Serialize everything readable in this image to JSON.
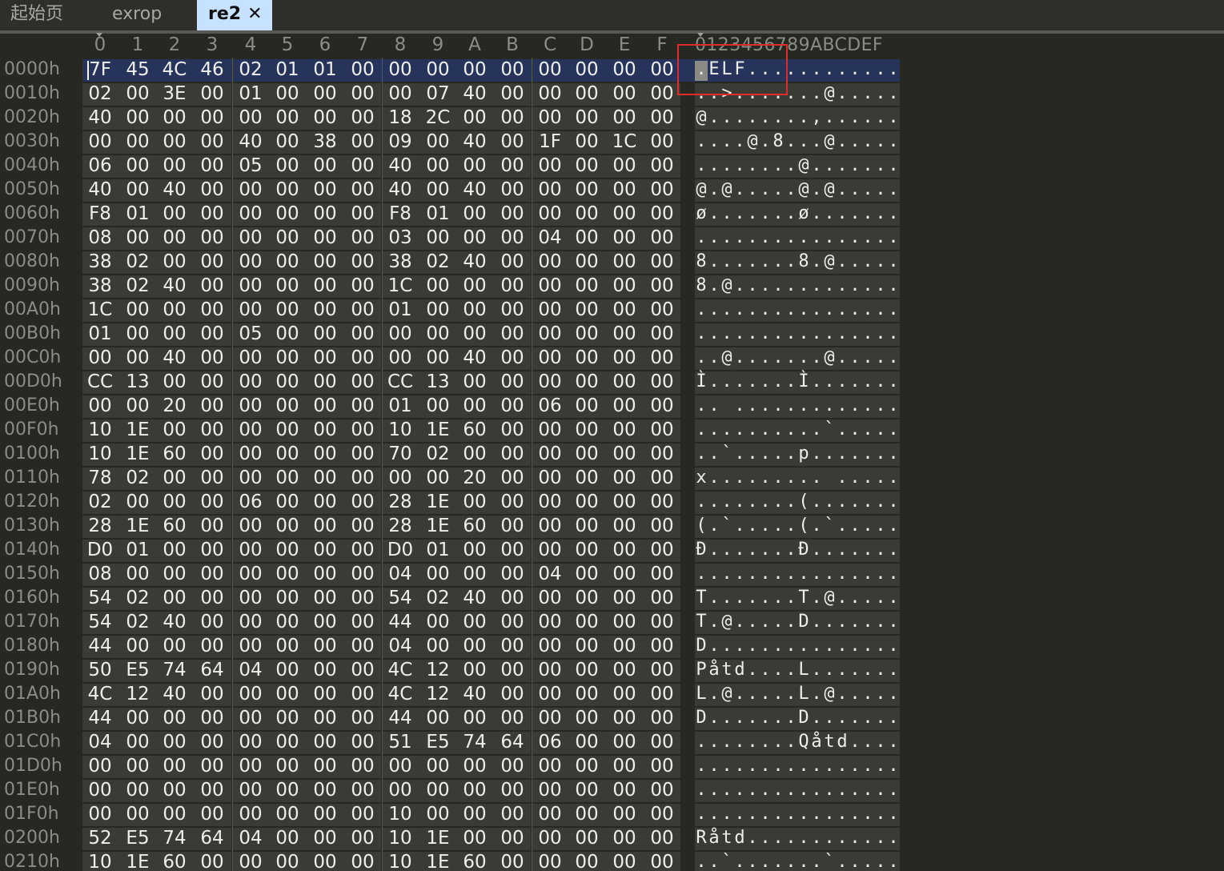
{
  "tabs": [
    {
      "label": "起始页",
      "active": false
    },
    {
      "label": "exrop",
      "active": false
    },
    {
      "label": "re2",
      "active": true
    }
  ],
  "tab_close_icon": "close-icon",
  "column_headers": [
    "0",
    "1",
    "2",
    "3",
    "4",
    "5",
    "6",
    "7",
    "8",
    "9",
    "A",
    "B",
    "C",
    "D",
    "E",
    "F"
  ],
  "ascii_header": "0123456789ABCDEF",
  "rows": [
    {
      "offset": "0000h",
      "bytes": [
        "7F",
        "45",
        "4C",
        "46",
        "02",
        "01",
        "01",
        "00",
        "00",
        "00",
        "00",
        "00",
        "00",
        "00",
        "00",
        "00"
      ],
      "ascii": ".ELF............"
    },
    {
      "offset": "0010h",
      "bytes": [
        "02",
        "00",
        "3E",
        "00",
        "01",
        "00",
        "00",
        "00",
        "00",
        "07",
        "40",
        "00",
        "00",
        "00",
        "00",
        "00"
      ],
      "ascii": "..>.......@....."
    },
    {
      "offset": "0020h",
      "bytes": [
        "40",
        "00",
        "00",
        "00",
        "00",
        "00",
        "00",
        "00",
        "18",
        "2C",
        "00",
        "00",
        "00",
        "00",
        "00",
        "00"
      ],
      "ascii": "@........,......"
    },
    {
      "offset": "0030h",
      "bytes": [
        "00",
        "00",
        "00",
        "00",
        "40",
        "00",
        "38",
        "00",
        "09",
        "00",
        "40",
        "00",
        "1F",
        "00",
        "1C",
        "00"
      ],
      "ascii": "....@.8...@....."
    },
    {
      "offset": "0040h",
      "bytes": [
        "06",
        "00",
        "00",
        "00",
        "05",
        "00",
        "00",
        "00",
        "40",
        "00",
        "00",
        "00",
        "00",
        "00",
        "00",
        "00"
      ],
      "ascii": "........@......."
    },
    {
      "offset": "0050h",
      "bytes": [
        "40",
        "00",
        "40",
        "00",
        "00",
        "00",
        "00",
        "00",
        "40",
        "00",
        "40",
        "00",
        "00",
        "00",
        "00",
        "00"
      ],
      "ascii": "@.@.....@.@....."
    },
    {
      "offset": "0060h",
      "bytes": [
        "F8",
        "01",
        "00",
        "00",
        "00",
        "00",
        "00",
        "00",
        "F8",
        "01",
        "00",
        "00",
        "00",
        "00",
        "00",
        "00"
      ],
      "ascii": "ø.......ø......."
    },
    {
      "offset": "0070h",
      "bytes": [
        "08",
        "00",
        "00",
        "00",
        "00",
        "00",
        "00",
        "00",
        "03",
        "00",
        "00",
        "00",
        "04",
        "00",
        "00",
        "00"
      ],
      "ascii": "................"
    },
    {
      "offset": "0080h",
      "bytes": [
        "38",
        "02",
        "00",
        "00",
        "00",
        "00",
        "00",
        "00",
        "38",
        "02",
        "40",
        "00",
        "00",
        "00",
        "00",
        "00"
      ],
      "ascii": "8.......8.@....."
    },
    {
      "offset": "0090h",
      "bytes": [
        "38",
        "02",
        "40",
        "00",
        "00",
        "00",
        "00",
        "00",
        "1C",
        "00",
        "00",
        "00",
        "00",
        "00",
        "00",
        "00"
      ],
      "ascii": "8.@............."
    },
    {
      "offset": "00A0h",
      "bytes": [
        "1C",
        "00",
        "00",
        "00",
        "00",
        "00",
        "00",
        "00",
        "01",
        "00",
        "00",
        "00",
        "00",
        "00",
        "00",
        "00"
      ],
      "ascii": "................"
    },
    {
      "offset": "00B0h",
      "bytes": [
        "01",
        "00",
        "00",
        "00",
        "05",
        "00",
        "00",
        "00",
        "00",
        "00",
        "00",
        "00",
        "00",
        "00",
        "00",
        "00"
      ],
      "ascii": "................"
    },
    {
      "offset": "00C0h",
      "bytes": [
        "00",
        "00",
        "40",
        "00",
        "00",
        "00",
        "00",
        "00",
        "00",
        "00",
        "40",
        "00",
        "00",
        "00",
        "00",
        "00"
      ],
      "ascii": "..@.......@....."
    },
    {
      "offset": "00D0h",
      "bytes": [
        "CC",
        "13",
        "00",
        "00",
        "00",
        "00",
        "00",
        "00",
        "CC",
        "13",
        "00",
        "00",
        "00",
        "00",
        "00",
        "00"
      ],
      "ascii": "Ì.......Ì......."
    },
    {
      "offset": "00E0h",
      "bytes": [
        "00",
        "00",
        "20",
        "00",
        "00",
        "00",
        "00",
        "00",
        "01",
        "00",
        "00",
        "00",
        "06",
        "00",
        "00",
        "00"
      ],
      "ascii": ".. ............."
    },
    {
      "offset": "00F0h",
      "bytes": [
        "10",
        "1E",
        "00",
        "00",
        "00",
        "00",
        "00",
        "00",
        "10",
        "1E",
        "60",
        "00",
        "00",
        "00",
        "00",
        "00"
      ],
      "ascii": "..........`....."
    },
    {
      "offset": "0100h",
      "bytes": [
        "10",
        "1E",
        "60",
        "00",
        "00",
        "00",
        "00",
        "00",
        "70",
        "02",
        "00",
        "00",
        "00",
        "00",
        "00",
        "00"
      ],
      "ascii": "..`.....p......."
    },
    {
      "offset": "0110h",
      "bytes": [
        "78",
        "02",
        "00",
        "00",
        "00",
        "00",
        "00",
        "00",
        "00",
        "00",
        "20",
        "00",
        "00",
        "00",
        "00",
        "00"
      ],
      "ascii": "x......... ....."
    },
    {
      "offset": "0120h",
      "bytes": [
        "02",
        "00",
        "00",
        "00",
        "06",
        "00",
        "00",
        "00",
        "28",
        "1E",
        "00",
        "00",
        "00",
        "00",
        "00",
        "00"
      ],
      "ascii": "........(......."
    },
    {
      "offset": "0130h",
      "bytes": [
        "28",
        "1E",
        "60",
        "00",
        "00",
        "00",
        "00",
        "00",
        "28",
        "1E",
        "60",
        "00",
        "00",
        "00",
        "00",
        "00"
      ],
      "ascii": "(.`.....(.`....."
    },
    {
      "offset": "0140h",
      "bytes": [
        "D0",
        "01",
        "00",
        "00",
        "00",
        "00",
        "00",
        "00",
        "D0",
        "01",
        "00",
        "00",
        "00",
        "00",
        "00",
        "00"
      ],
      "ascii": "Ð.......Ð......."
    },
    {
      "offset": "0150h",
      "bytes": [
        "08",
        "00",
        "00",
        "00",
        "00",
        "00",
        "00",
        "00",
        "04",
        "00",
        "00",
        "00",
        "04",
        "00",
        "00",
        "00"
      ],
      "ascii": "................"
    },
    {
      "offset": "0160h",
      "bytes": [
        "54",
        "02",
        "00",
        "00",
        "00",
        "00",
        "00",
        "00",
        "54",
        "02",
        "40",
        "00",
        "00",
        "00",
        "00",
        "00"
      ],
      "ascii": "T.......T.@....."
    },
    {
      "offset": "0170h",
      "bytes": [
        "54",
        "02",
        "40",
        "00",
        "00",
        "00",
        "00",
        "00",
        "44",
        "00",
        "00",
        "00",
        "00",
        "00",
        "00",
        "00"
      ],
      "ascii": "T.@.....D......."
    },
    {
      "offset": "0180h",
      "bytes": [
        "44",
        "00",
        "00",
        "00",
        "00",
        "00",
        "00",
        "00",
        "04",
        "00",
        "00",
        "00",
        "00",
        "00",
        "00",
        "00"
      ],
      "ascii": "D..............."
    },
    {
      "offset": "0190h",
      "bytes": [
        "50",
        "E5",
        "74",
        "64",
        "04",
        "00",
        "00",
        "00",
        "4C",
        "12",
        "00",
        "00",
        "00",
        "00",
        "00",
        "00"
      ],
      "ascii": "Påtd....L......."
    },
    {
      "offset": "01A0h",
      "bytes": [
        "4C",
        "12",
        "40",
        "00",
        "00",
        "00",
        "00",
        "00",
        "4C",
        "12",
        "40",
        "00",
        "00",
        "00",
        "00",
        "00"
      ],
      "ascii": "L.@.....L.@....."
    },
    {
      "offset": "01B0h",
      "bytes": [
        "44",
        "00",
        "00",
        "00",
        "00",
        "00",
        "00",
        "00",
        "44",
        "00",
        "00",
        "00",
        "00",
        "00",
        "00",
        "00"
      ],
      "ascii": "D.......D......."
    },
    {
      "offset": "01C0h",
      "bytes": [
        "04",
        "00",
        "00",
        "00",
        "00",
        "00",
        "00",
        "00",
        "51",
        "E5",
        "74",
        "64",
        "06",
        "00",
        "00",
        "00"
      ],
      "ascii": "........Qåtd...."
    },
    {
      "offset": "01D0h",
      "bytes": [
        "00",
        "00",
        "00",
        "00",
        "00",
        "00",
        "00",
        "00",
        "00",
        "00",
        "00",
        "00",
        "00",
        "00",
        "00",
        "00"
      ],
      "ascii": "................"
    },
    {
      "offset": "01E0h",
      "bytes": [
        "00",
        "00",
        "00",
        "00",
        "00",
        "00",
        "00",
        "00",
        "00",
        "00",
        "00",
        "00",
        "00",
        "00",
        "00",
        "00"
      ],
      "ascii": "................"
    },
    {
      "offset": "01F0h",
      "bytes": [
        "00",
        "00",
        "00",
        "00",
        "00",
        "00",
        "00",
        "00",
        "10",
        "00",
        "00",
        "00",
        "00",
        "00",
        "00",
        "00"
      ],
      "ascii": "................"
    },
    {
      "offset": "0200h",
      "bytes": [
        "52",
        "E5",
        "74",
        "64",
        "04",
        "00",
        "00",
        "00",
        "10",
        "1E",
        "00",
        "00",
        "00",
        "00",
        "00",
        "00"
      ],
      "ascii": "Råtd............"
    },
    {
      "offset": "0210h",
      "bytes": [
        "10",
        "1E",
        "60",
        "00",
        "00",
        "00",
        "00",
        "00",
        "10",
        "1E",
        "60",
        "00",
        "00",
        "00",
        "00",
        "00"
      ],
      "ascii": "..`.......`....."
    }
  ],
  "colors": {
    "background": "#272822",
    "active_tab": "#c6e2ff",
    "selected_row": "#26345c",
    "highlight_box": "#e12a2a"
  }
}
